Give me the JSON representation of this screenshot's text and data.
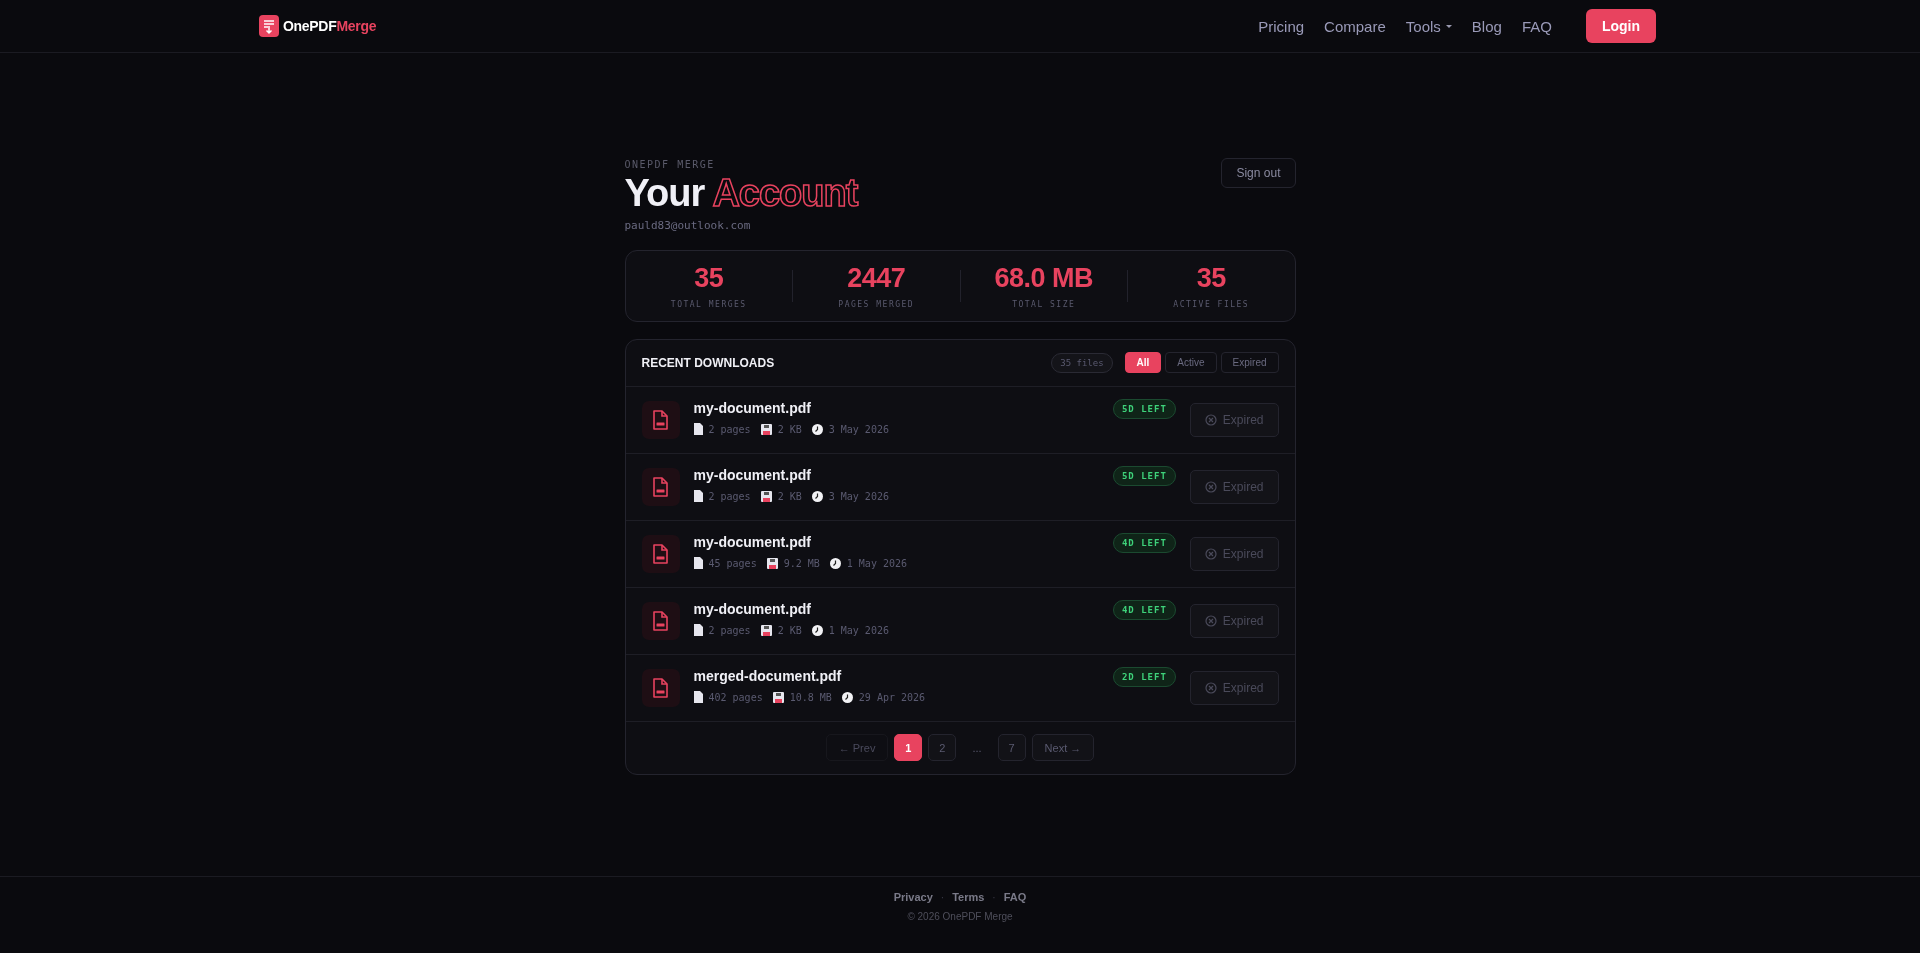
{
  "nav": {
    "brand": {
      "first": "OnePDF",
      "second": "Merge"
    },
    "links": [
      {
        "label": "Pricing",
        "dropdown": false
      },
      {
        "label": "Compare",
        "dropdown": false
      },
      {
        "label": "Tools",
        "dropdown": true
      },
      {
        "label": "Blog",
        "dropdown": false
      },
      {
        "label": "FAQ",
        "dropdown": false
      }
    ],
    "login": "Login"
  },
  "account": {
    "eyebrow": "ONEPDF MERGE",
    "title_plain": "Your",
    "title_outline": "Account",
    "email": "pauld83@outlook.com",
    "sign_out": "Sign out"
  },
  "stats": [
    {
      "value": "35",
      "label": "TOTAL MERGES"
    },
    {
      "value": "2447",
      "label": "PAGES MERGED"
    },
    {
      "value": "68.0 MB",
      "label": "TOTAL SIZE"
    },
    {
      "value": "35",
      "label": "ACTIVE FILES"
    }
  ],
  "downloads": {
    "title": "RECENT DOWNLOADS",
    "count": "35 files",
    "filters": [
      {
        "label": "All",
        "selected": true
      },
      {
        "label": "Active",
        "selected": false
      },
      {
        "label": "Expired",
        "selected": false
      }
    ],
    "rows": [
      {
        "name": "my-document.pdf",
        "pages": "2 pages",
        "size": "2 KB",
        "date": "3 May 2026",
        "badge": "5D LEFT",
        "action": "Expired",
        "disabled": true
      },
      {
        "name": "my-document.pdf",
        "pages": "2 pages",
        "size": "2 KB",
        "date": "3 May 2026",
        "badge": "5D LEFT",
        "action": "Expired",
        "disabled": true
      },
      {
        "name": "my-document.pdf",
        "pages": "45 pages",
        "size": "9.2 MB",
        "date": "1 May 2026",
        "badge": "4D LEFT",
        "action": "Expired",
        "disabled": true
      },
      {
        "name": "my-document.pdf",
        "pages": "2 pages",
        "size": "2 KB",
        "date": "1 May 2026",
        "badge": "4D LEFT",
        "action": "Expired",
        "disabled": true
      },
      {
        "name": "merged-document.pdf",
        "pages": "402 pages",
        "size": "10.8 MB",
        "date": "29 Apr 2026",
        "badge": "2D LEFT",
        "action": "Expired",
        "disabled": true
      }
    ],
    "pagination": [
      {
        "kind": "nav",
        "label": "← Prev",
        "disabled": true
      },
      {
        "kind": "page",
        "label": "1",
        "selected": true
      },
      {
        "kind": "page",
        "label": "2",
        "selected": false
      },
      {
        "kind": "ellipsis",
        "label": "..."
      },
      {
        "kind": "page",
        "label": "7",
        "selected": false
      },
      {
        "kind": "nav",
        "label": "Next →",
        "disabled": false
      }
    ]
  },
  "footer": {
    "links": [
      "Privacy",
      "Terms",
      "FAQ"
    ],
    "separator": "·",
    "copyright": "© 2026 OnePDF Merge"
  }
}
